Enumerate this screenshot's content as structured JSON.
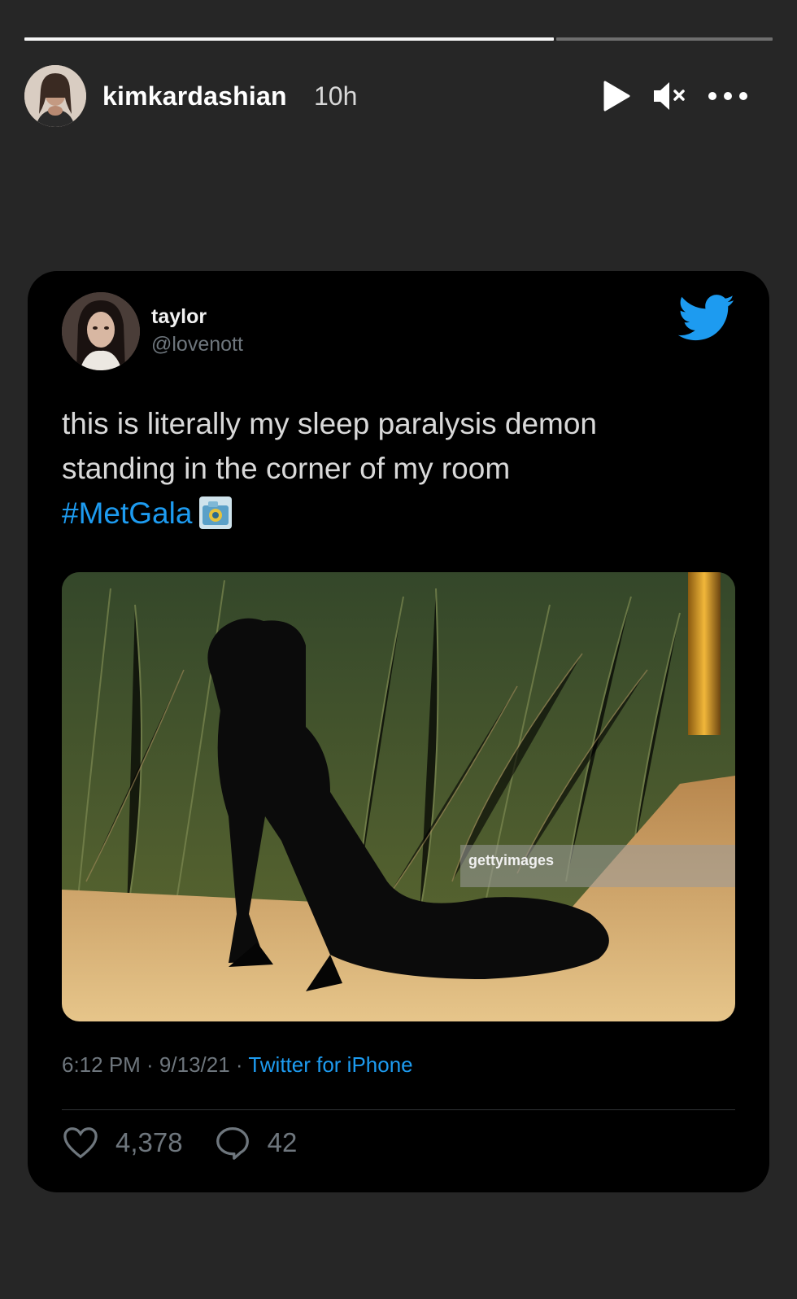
{
  "story": {
    "progress": {
      "segments": 2,
      "completed": 0.71
    },
    "header": {
      "username": "kimkardashian",
      "time": "10h"
    },
    "icons": {
      "play": "play-icon",
      "mute": "mute-icon",
      "more": "more-icon"
    }
  },
  "tweet": {
    "author_name": "taylor",
    "author_handle": "@lovenott",
    "text_line": "this is literally my sleep paralysis demon standing in the corner of my room",
    "hashtag": "#MetGala",
    "media_watermark": "gettyimages",
    "timestamp": "6:12 PM · 9/13/21 · ",
    "source": "Twitter for iPhone",
    "likes": "4,378",
    "replies": "42",
    "brand_color": "#1d9bf0"
  }
}
